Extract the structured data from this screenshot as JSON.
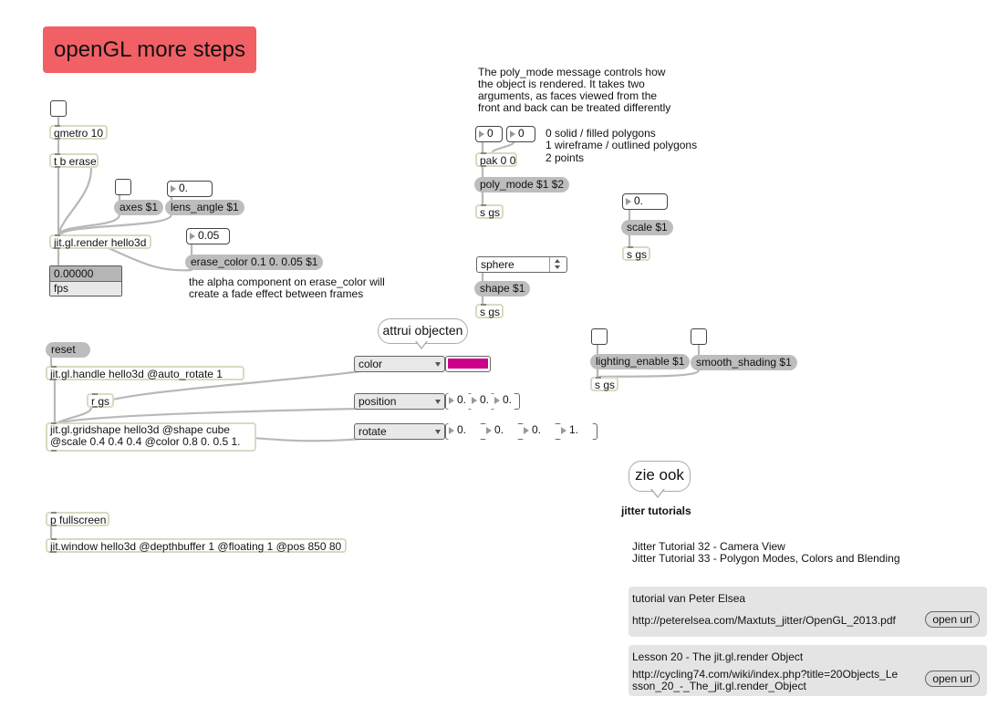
{
  "title": "openGL more steps",
  "colors": {
    "title_bg": "#f16065",
    "swatch": "#cc0088"
  },
  "objects": {
    "qmetro": "qmetro 10",
    "tberase": "t b erase",
    "axes": "axes $1",
    "lens": "lens_angle $1",
    "render": "jit.gl.render hello3d",
    "erase": "erase_color 0.1 0. 0.05 $1",
    "fps_value": "0.00000",
    "fps_label": "fps",
    "reset": "reset",
    "handle": "jit.gl.handle hello3d @auto_rotate 1",
    "rgs": "r gs",
    "gridshape1": "jit.gl.gridshape hello3d @shape cube",
    "gridshape2": "@scale 0.4 0.4 0.4 @color 0.8 0. 0.5 1.",
    "pfullscreen": "p fullscreen",
    "window": "jit.window hello3d @depthbuffer 1 @floating 1 @pos 850 80",
    "pak": "pak 0 0",
    "polymode": "poly_mode $1 $2",
    "sgs": "s gs",
    "shape": "shape $1",
    "scale": "scale $1",
    "lighting": "lighting_enable $1",
    "smooth": "smooth_shading $1"
  },
  "numbers": {
    "lens": "0.",
    "erase": "0.05",
    "pak1": "0",
    "pak2": "0",
    "scale": "0.",
    "pos_x": "0.",
    "pos_y": "0.",
    "pos_z": "0.",
    "rot_a": "0.",
    "rot_b": "0.",
    "rot_c": "0.",
    "rot_d": "1."
  },
  "menus": {
    "shape": "sphere",
    "color": "color",
    "position": "position",
    "rotate": "rotate"
  },
  "comments": {
    "polymode_1": "The poly_mode message controls how",
    "polymode_2": "the object is rendered. It takes two",
    "polymode_3": "arguments, as faces viewed from the",
    "polymode_4": "front and back can be treated differently",
    "mode0": "0 solid / filled polygons",
    "mode1": "1 wireframe / outlined polygons",
    "mode2": "2 points",
    "alpha_1": "the alpha component on erase_color will",
    "alpha_2": "create a fade effect between frames",
    "attrui": "attrui objecten",
    "zie": "zie ook",
    "jitter": "jitter tutorials",
    "tut32": "Jitter Tutorial 32 - Camera View",
    "tut33": "Jitter Tutorial 33 - Polygon Modes, Colors and Blending"
  },
  "panels": {
    "elsea_title": "tutorial van Peter Elsea",
    "elsea_url": "http://peterelsea.com/Maxtuts_jitter/OpenGL_2013.pdf",
    "lesson_title": "Lesson 20 - The jit.gl.render Object",
    "lesson_url_1": "http://cycling74.com/wiki/index.php?title=20Objects_Le",
    "lesson_url_2": "sson_20_-_The_jit.gl.render_Object",
    "open_url": "open url"
  }
}
